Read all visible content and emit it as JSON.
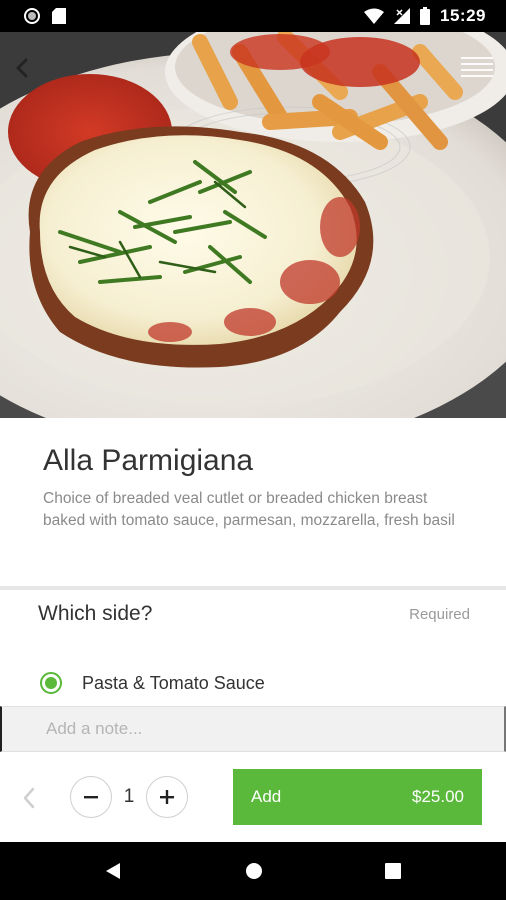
{
  "status_bar": {
    "time": "15:29"
  },
  "item": {
    "title": "Alla Parmigiana",
    "description": "Choice of breaded veal cutlet or breaded chicken breast baked with tomato sauce, parmesan, mozzarella, fresh basil"
  },
  "option_group": {
    "title": "Which side?",
    "required_label": "Required",
    "options": [
      {
        "label": "Pasta & Tomato Sauce",
        "selected": true
      }
    ]
  },
  "note": {
    "placeholder": "Add a note..."
  },
  "order": {
    "quantity": "1",
    "add_label": "Add",
    "price": "$25.00"
  },
  "colors": {
    "accent": "#5ab83a",
    "status_bar": "#000000",
    "divider": "#e6e6e6"
  },
  "icons": [
    "back-arrow-icon",
    "menu-icon",
    "chevron-left-icon",
    "minus-icon",
    "plus-icon",
    "nav-back-icon",
    "nav-home-icon",
    "nav-recent-icon",
    "wifi-icon",
    "signal-icon",
    "battery-icon"
  ]
}
